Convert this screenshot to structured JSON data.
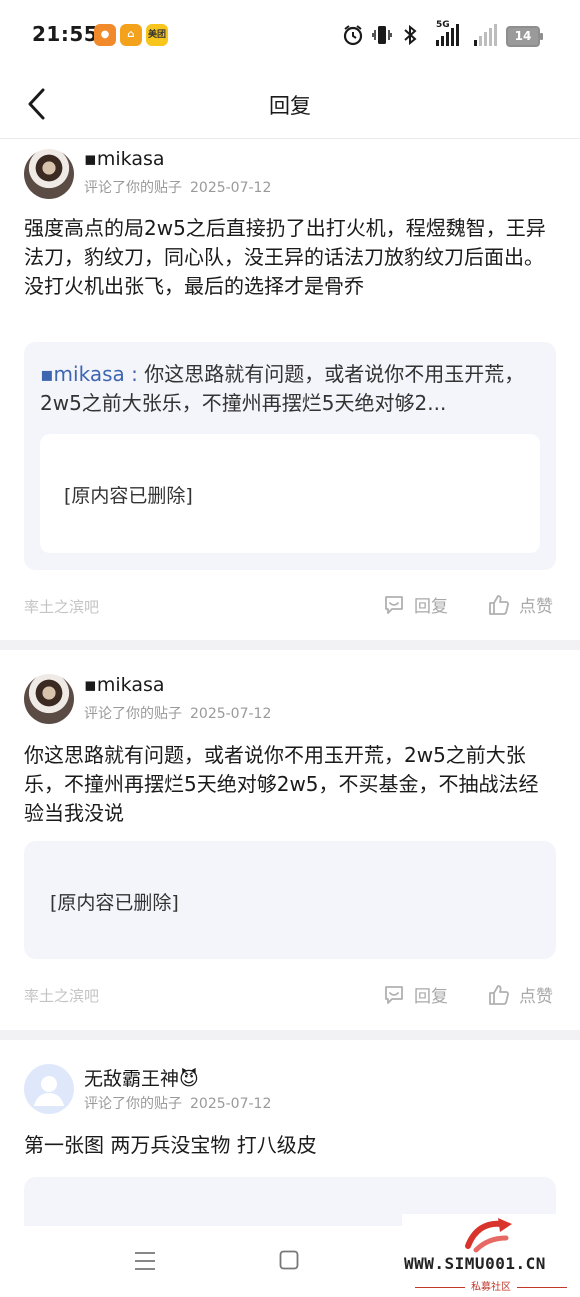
{
  "status_bar": {
    "time": "21:55",
    "app_icons": [
      {
        "name": "app-orange-icon",
        "label": "",
        "color": "#f08a2b"
      },
      {
        "name": "app-amap-icon",
        "label": "",
        "color": "#f4a11b"
      },
      {
        "name": "app-meituan-icon",
        "label": "美团",
        "color": "#f7c51b"
      }
    ],
    "network_label": "5G",
    "battery": "14"
  },
  "header": {
    "title": "回复"
  },
  "replies": [
    {
      "username": "▪mikasa",
      "action": "评论了你的贴子",
      "date": "2025-07-12",
      "text": "强度高点的局2w5之后直接扔了出打火机，程煜魏智，王异法刀，豹纹刀，同心队，没王异的话法刀放豹纹刀后面出。没打火机出张飞，最后的选择才是骨乔",
      "quote_author": "▪mikasa",
      "quote_sep": " : ",
      "quote_text": "你这思路就有问题，或者说你不用玉开荒，2w5之前大张乐，不撞州再摆烂5天绝对够2...",
      "deleted": "[原内容已删除]",
      "forum": "率土之滨吧",
      "reply_label": "回复",
      "like_label": "点赞"
    },
    {
      "username": "▪mikasa",
      "action": "评论了你的贴子",
      "date": "2025-07-12",
      "text": "你这思路就有问题，或者说你不用玉开荒，2w5之前大张乐，不撞州再摆烂5天绝对够2w5，不买基金，不抽战法经验当我没说",
      "deleted": "[原内容已删除]",
      "forum": "率土之滨吧",
      "reply_label": "回复",
      "like_label": "点赞"
    },
    {
      "username": "无敌霸王神😈",
      "action": "评论了你的贴子",
      "date": "2025-07-12",
      "text": "第一张图 两万兵没宝物 打八级皮"
    }
  ],
  "watermark": {
    "url": "WWW.SIMU001.CN",
    "subtitle": "私募社区"
  },
  "colors": {
    "link": "#3d65b0",
    "quote_bg": "#f4f4fb",
    "muted": "#a8a8a8"
  }
}
